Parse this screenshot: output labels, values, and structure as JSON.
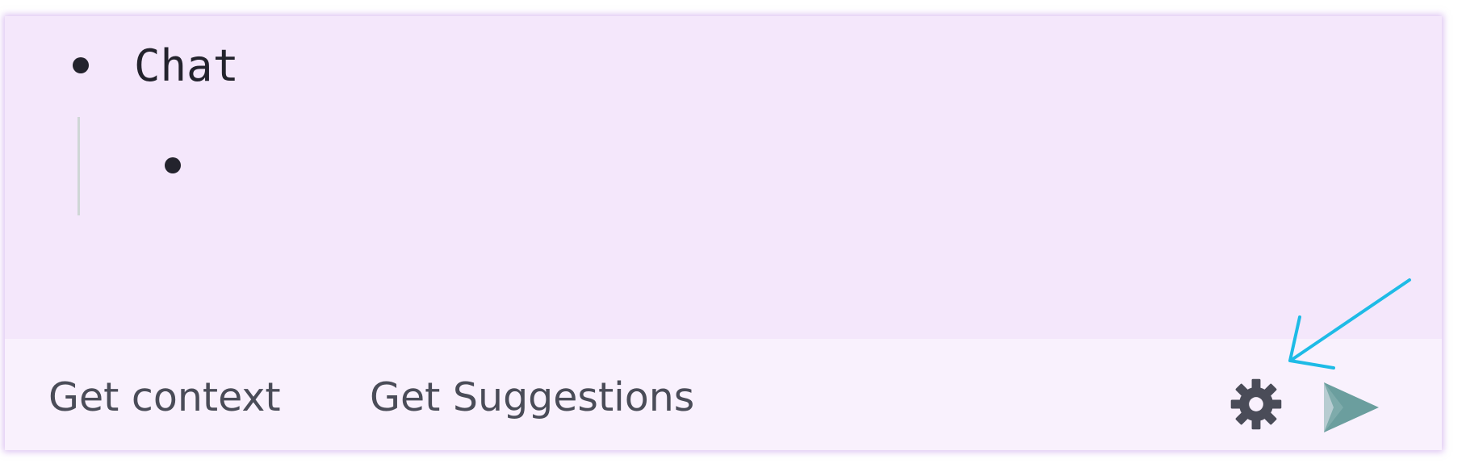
{
  "editor": {
    "items": [
      {
        "label": "Chat"
      },
      {
        "label": ""
      }
    ]
  },
  "toolbar": {
    "get_context_label": "Get context",
    "get_suggestions_label": "Get Suggestions",
    "settings_icon": "gear-icon",
    "send_icon": "send-icon"
  },
  "colors": {
    "panel_background": "#f4e7fb",
    "toolbar_background": "#f9f1fd",
    "send_accent": "#6b9e9e",
    "annotation_arrow": "#1ebbe6"
  }
}
